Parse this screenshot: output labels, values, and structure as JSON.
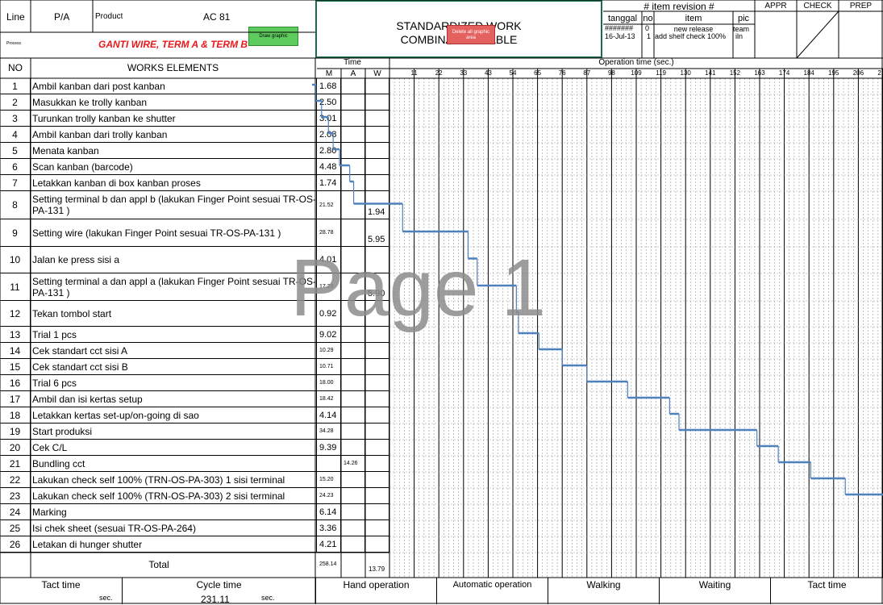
{
  "header": {
    "line_label": "Line",
    "pa_label": "P/A",
    "product_label": "Product",
    "product_value": "AC 81",
    "process_label": "Process",
    "process_name": "GANTI WIRE, TERM A & TERM B",
    "draw_button": "Draw graphic",
    "title_line1": "STANDARDIZED WORK",
    "title_line2": "COMBINATION TABLE",
    "delete_button": "Delete all graphic area",
    "revision_title": "# item revision #",
    "rev_col_tanggal": "tanggal",
    "rev_col_no": "no",
    "rev_col_item": "item",
    "rev_col_pic": "pic",
    "rev_rows": [
      {
        "tanggal": "#######",
        "no": "0",
        "item": "new release",
        "pic": "team"
      },
      {
        "tanggal": "16-Jul-13",
        "no": "1",
        "item": "add shelf check 100%",
        "pic": "iln"
      }
    ],
    "appr": "APPR",
    "check": "CHECK",
    "prep": "PREP"
  },
  "columns": {
    "no": "NO",
    "works": "WORKS ELEMENTS",
    "time": "Time",
    "m": "M",
    "a": "A",
    "w": "W",
    "operation_time": "Operation time (sec.)"
  },
  "ticks": [
    "11",
    "22",
    "33",
    "43",
    "54",
    "65",
    "76",
    "87",
    "98",
    "109",
    "119",
    "130",
    "141",
    "152",
    "163",
    "174",
    "184",
    "195",
    "206",
    "217"
  ],
  "rows": [
    {
      "no": "1",
      "text": "Ambil kanban dari post kanban",
      "m": "1.68",
      "a": "",
      "w": ""
    },
    {
      "no": "2",
      "text": "Masukkan ke trolly kanban",
      "m": "2.50",
      "a": "",
      "w": ""
    },
    {
      "no": "3",
      "text": "Turunkan trolly kanban ke shutter",
      "m": "3.01",
      "a": "",
      "w": ""
    },
    {
      "no": "4",
      "text": "Ambil kanban dari trolly kanban",
      "m": "2.08",
      "a": "",
      "w": ""
    },
    {
      "no": "5",
      "text": "Menata kanban",
      "m": "2.80",
      "a": "",
      "w": ""
    },
    {
      "no": "6",
      "text": "Scan kanban (barcode)",
      "m": "4.48",
      "a": "",
      "w": ""
    },
    {
      "no": "7",
      "text": "Letakkan kanban di box kanban proses",
      "m": "1.74",
      "a": "",
      "w": ""
    },
    {
      "no": "8",
      "text": "Setting terminal b dan appl b (lakukan Finger Point sesuai TR-OS-PA-131 )",
      "m": "21.52",
      "a": "",
      "w": "1.94"
    },
    {
      "no": "9",
      "text": "Setting wire (lakukan Finger Point sesuai TR-OS-PA-131 )",
      "m": "28.78",
      "a": "",
      "w": "5.95"
    },
    {
      "no": "10",
      "text": "Jalan ke press sisi a",
      "m": "4.01",
      "a": "",
      "w": ""
    },
    {
      "no": "11",
      "text": "Setting terminal a dan appl a (lakukan Finger Point sesuai TR-OS-PA-131 )",
      "m": "17.23",
      "a": "",
      "w": "5.90"
    },
    {
      "no": "12",
      "text": "Tekan tombol start",
      "m": "0.92",
      "a": "",
      "w": ""
    },
    {
      "no": "13",
      "text": "Trial 1 pcs",
      "m": "9.02",
      "a": "",
      "w": ""
    },
    {
      "no": "14",
      "text": "Cek standart cct sisi A",
      "m": "10.29",
      "a": "",
      "w": ""
    },
    {
      "no": "15",
      "text": "Cek standart cct sisi B",
      "m": "10.71",
      "a": "",
      "w": ""
    },
    {
      "no": "16",
      "text": "Trial 6 pcs",
      "m": "18.00",
      "a": "",
      "w": ""
    },
    {
      "no": "17",
      "text": "Ambil dan isi kertas setup",
      "m": "18.42",
      "a": "",
      "w": ""
    },
    {
      "no": "18",
      "text": "Letakkan kertas set-up/on-going di sao",
      "m": "4.14",
      "a": "",
      "w": ""
    },
    {
      "no": "19",
      "text": "Start produksi",
      "m": "34.28",
      "a": "",
      "w": ""
    },
    {
      "no": "20",
      "text": "Cek C/L",
      "m": "9.39",
      "a": "",
      "w": ""
    },
    {
      "no": "21",
      "text": "Bundling cct",
      "m": "",
      "a": "14.26",
      "w": ""
    },
    {
      "no": "22",
      "text": "Lakukan check self 100% (TRN-OS-PA-303) 1 sisi terminal",
      "m": "15.20",
      "a": "",
      "w": ""
    },
    {
      "no": "23",
      "text": "Lakukan check self 100% (TRN-OS-PA-303) 2 sisi terminal",
      "m": "24.23",
      "a": "",
      "w": ""
    },
    {
      "no": "24",
      "text": "Marking",
      "m": "6.14",
      "a": "",
      "w": ""
    },
    {
      "no": "25",
      "text": "Isi chek sheet (sesuai TR-OS-PA-264)",
      "m": "3.36",
      "a": "",
      "w": ""
    },
    {
      "no": "26",
      "text": "Letakan di hunger shutter",
      "m": "4.21",
      "a": "",
      "w": ""
    }
  ],
  "total": {
    "label": "Total",
    "m": "258.14",
    "w": "13.79"
  },
  "watermark": "Page 1",
  "footer": {
    "tact_time": "Tact time",
    "sec": "sec.",
    "cycle_time": "Cycle time",
    "cycle_value": "231.11",
    "sec2": "sec.",
    "hand": "Hand operation",
    "auto": "Automatic operation",
    "walking": "Walking",
    "waiting": "Waiting",
    "tact_time2": "Tact time"
  },
  "colors": {
    "accent_red": "#e8181c",
    "line_blue": "#4f81bd",
    "button_green": "#5ecb5e",
    "button_red": "#e4615f",
    "title_border": "#1c6b4a"
  }
}
